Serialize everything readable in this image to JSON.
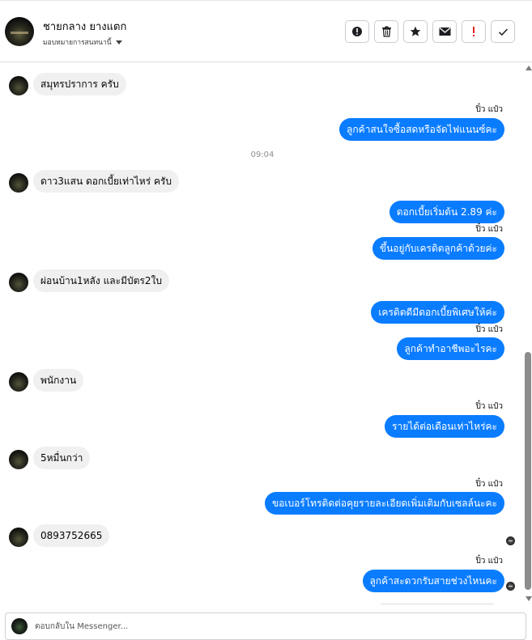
{
  "header": {
    "name": "ชายกลาง ยางแตก",
    "assign_label": "มอบหมายการสนทนานี้",
    "tools": [
      {
        "icon": "info-circle-icon"
      },
      {
        "icon": "trash-icon"
      },
      {
        "icon": "star-icon"
      },
      {
        "icon": "envelope-icon"
      },
      {
        "icon": "exclamation-icon",
        "color": "#e02424"
      },
      {
        "icon": "checkmark-icon"
      }
    ]
  },
  "conversation": {
    "sender_name": "ปิ๋ว แป๋ว",
    "timestamp": "09:04",
    "messages": [
      {
        "dir": "in",
        "text": "สมุทรปราการ ครับ"
      },
      {
        "dir": "out",
        "text": "ลูกค้าสนใจซื้อสดหรือจัดไฟแนนซ์คะ"
      },
      {
        "dir": "in",
        "text": "ดาว3แสน ดอกเบี้ยเท่าไหร่ ครับ"
      },
      {
        "dir": "out",
        "text": "ดอกเบี้ยเริ่มต้น 2.89 ค่ะ"
      },
      {
        "dir": "out",
        "text": "ขึ้นอยู่กับเครดิตลูกค้าด้วยค่ะ"
      },
      {
        "dir": "in",
        "text": "ผ่อนบ้าน1หลัง และมีบัตร2ใบ"
      },
      {
        "dir": "out",
        "text": "เครดิตดีมีดอกเบี้ยพิเศษให้ค่ะ"
      },
      {
        "dir": "out",
        "text": "ลูกค้าทำอาชีพอะไรคะ"
      },
      {
        "dir": "in",
        "text": "พนักงาน"
      },
      {
        "dir": "out",
        "text": "รายได้ต่อเดือนเท่าไหร่คะ"
      },
      {
        "dir": "in",
        "text": "5หมื่นกว่า"
      },
      {
        "dir": "out",
        "text": "ขอเบอร์โทรติดต่อคุยรายละเอียดเพิ่มเติมกับเซลล์นะคะ"
      },
      {
        "dir": "in",
        "text": "0893752665"
      },
      {
        "dir": "out",
        "text": "ลูกค้าสะดวกรับสายช่วงไหนคะ"
      }
    ]
  },
  "composer": {
    "placeholder": "ตอบกลับใน Messenger..."
  },
  "colors": {
    "outgoing_bubble": "#0a7cff",
    "incoming_bubble": "#f0f0f0",
    "alert_red": "#e02424"
  }
}
